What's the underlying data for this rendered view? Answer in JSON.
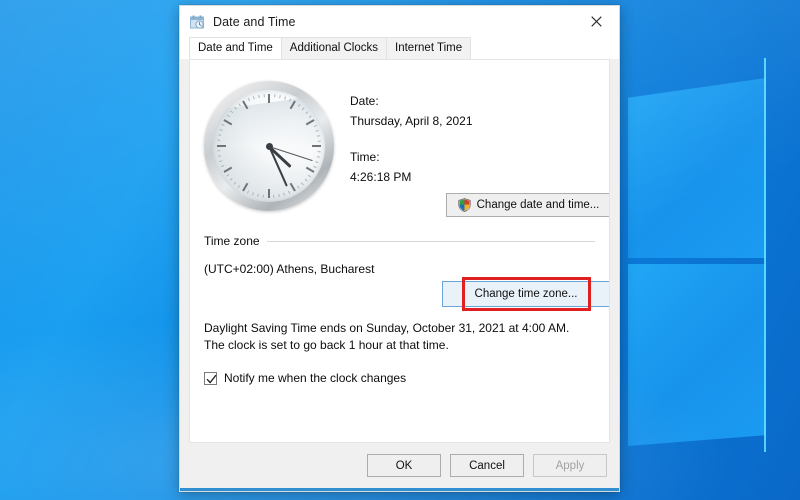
{
  "window": {
    "title": "Date and Time",
    "icon": "date-time-icon",
    "close_label": "✕"
  },
  "tabs": [
    {
      "label": "Date and Time",
      "active": true
    },
    {
      "label": "Additional Clocks",
      "active": false
    },
    {
      "label": "Internet Time",
      "active": false
    }
  ],
  "clock": {
    "hour_angle": 133,
    "minute_angle": 156,
    "second_angle": 108
  },
  "datetime": {
    "date_label": "Date:",
    "date_value": "Thursday, April 8, 2021",
    "time_label": "Time:",
    "time_value": "4:26:18 PM",
    "change_button": "Change date and time..."
  },
  "timezone": {
    "group_label": "Time zone",
    "value": "(UTC+02:00) Athens, Bucharest",
    "change_button": "Change time zone..."
  },
  "dst": {
    "text": "Daylight Saving Time ends on Sunday, October 31, 2021 at 4:00 AM. The clock is set to go back 1 hour at that time.",
    "notify_label": "Notify me when the clock changes",
    "notify_checked": true
  },
  "footer": {
    "ok": "OK",
    "cancel": "Cancel",
    "apply": "Apply",
    "apply_disabled": true
  },
  "colors": {
    "annotation": "#e02020",
    "focus_border": "#6aa5d6",
    "accent": "#2f8fd0",
    "desktop_blue": "#0f8fe8"
  }
}
